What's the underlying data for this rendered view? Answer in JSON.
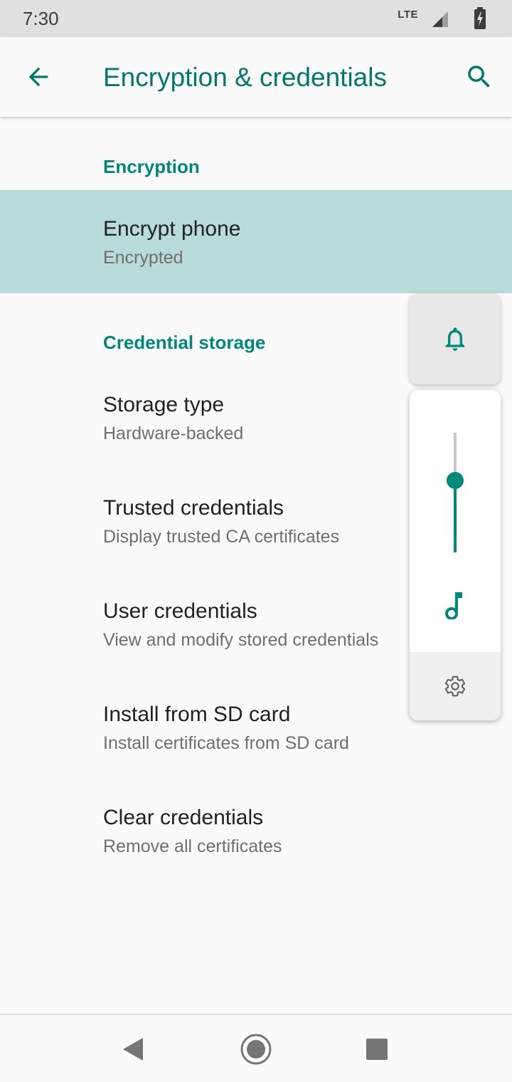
{
  "status_bar": {
    "time": "7:30",
    "network": "LTE",
    "icons": [
      "signal-icon",
      "battery-charging-icon"
    ]
  },
  "app_bar": {
    "title": "Encryption & credentials",
    "back_icon": "arrow-back-icon",
    "search_icon": "search-icon"
  },
  "sections": [
    {
      "header": "Encryption",
      "items": [
        {
          "title": "Encrypt phone",
          "summary": "Encrypted",
          "highlighted": true
        }
      ]
    },
    {
      "header": "Credential storage",
      "items": [
        {
          "title": "Storage type",
          "summary": "Hardware-backed"
        },
        {
          "title": "Trusted credentials",
          "summary": "Display trusted CA certificates"
        },
        {
          "title": "User credentials",
          "summary": "View and modify stored credentials"
        },
        {
          "title": "Install from SD card",
          "summary": "Install certificates from SD card"
        },
        {
          "title": "Clear credentials",
          "summary": "Remove all certificates"
        }
      ]
    }
  ],
  "volume_dialog": {
    "ringer_icon": "bell-icon",
    "stream_icon": "music-note-icon",
    "settings_icon": "gear-icon",
    "level": 0.6
  },
  "nav_bar": {
    "icons": [
      "nav-back-icon",
      "nav-home-icon",
      "nav-recents-icon"
    ]
  },
  "colors": {
    "accent": "#00796b",
    "highlight": "#b7dbd8",
    "status_bar": "#e0e0e0"
  }
}
